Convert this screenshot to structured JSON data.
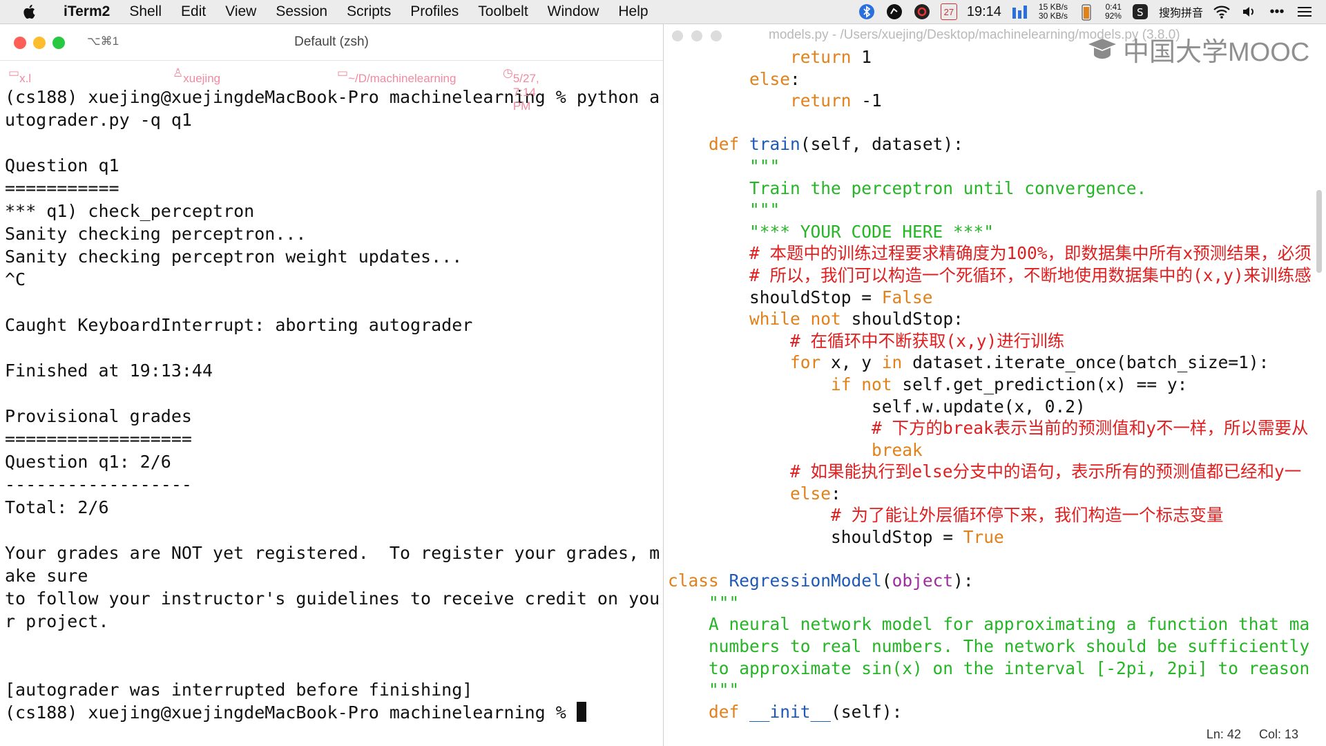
{
  "menubar": {
    "app_name": "iTerm2",
    "items": [
      "Shell",
      "Edit",
      "View",
      "Session",
      "Scripts",
      "Profiles",
      "Toolbelt",
      "Window",
      "Help"
    ],
    "status": {
      "date_day": "27",
      "time": "19:14",
      "net_up": "15 KB/s",
      "net_down": "30 KB/s",
      "battery_time": "0:41",
      "battery_pct": "92%",
      "ime": "搜狗拼音"
    }
  },
  "terminal": {
    "hotkey": "⌥⌘1",
    "title": "Default (zsh)",
    "info": {
      "host": "x.l",
      "user": "xuejing",
      "dir": "~/D/machinelearning",
      "datetime": "5/27, 7:14 PM"
    },
    "lines": [
      "(cs188) xuejing@xuejingdeMacBook-Pro machinelearning % python a",
      "utograder.py -q q1",
      "",
      "Question q1",
      "===========",
      "*** q1) check_perceptron",
      "Sanity checking perceptron...",
      "Sanity checking perceptron weight updates...",
      "^C",
      "",
      "Caught KeyboardInterrupt: aborting autograder",
      "",
      "Finished at 19:13:44",
      "",
      "Provisional grades",
      "==================",
      "Question q1: 2/6",
      "------------------",
      "Total: 2/6",
      "",
      "Your grades are NOT yet registered.  To register your grades, m",
      "ake sure",
      "to follow your instructor's guidelines to receive credit on you",
      "r project.",
      "",
      "",
      "[autograder was interrupted before finishing]"
    ],
    "prompt": "(cs188) xuejing@xuejingdeMacBook-Pro machinelearning % "
  },
  "editor": {
    "title": "models.py - /Users/xuejing/Desktop/machinelearning/models.py (3.8.0)",
    "watermark": "中国大学MOOC",
    "code": [
      [
        {
          "t": "            ",
          "c": "txt"
        },
        {
          "t": "return",
          "c": "kw"
        },
        {
          "t": " 1",
          "c": "txt"
        }
      ],
      [
        {
          "t": "        ",
          "c": "txt"
        },
        {
          "t": "else",
          "c": "kw"
        },
        {
          "t": ":",
          "c": "txt"
        }
      ],
      [
        {
          "t": "            ",
          "c": "txt"
        },
        {
          "t": "return",
          "c": "kw"
        },
        {
          "t": " -1",
          "c": "txt"
        }
      ],
      [
        {
          "t": "",
          "c": "txt"
        }
      ],
      [
        {
          "t": "    ",
          "c": "txt"
        },
        {
          "t": "def",
          "c": "def"
        },
        {
          "t": " ",
          "c": "txt"
        },
        {
          "t": "train",
          "c": "fn"
        },
        {
          "t": "(self, dataset):",
          "c": "txt"
        }
      ],
      [
        {
          "t": "        ",
          "c": "txt"
        },
        {
          "t": "\"\"\"",
          "c": "str"
        }
      ],
      [
        {
          "t": "        ",
          "c": "txt"
        },
        {
          "t": "Train the perceptron until convergence.",
          "c": "str"
        }
      ],
      [
        {
          "t": "        ",
          "c": "txt"
        },
        {
          "t": "\"\"\"",
          "c": "str"
        }
      ],
      [
        {
          "t": "        ",
          "c": "txt"
        },
        {
          "t": "\"*** YOUR CODE HERE ***\"",
          "c": "str"
        }
      ],
      [
        {
          "t": "        ",
          "c": "txt"
        },
        {
          "t": "# 本题中的训练过程要求精确度为100%，即数据集中所有x预测结果，必须",
          "c": "cm"
        }
      ],
      [
        {
          "t": "        ",
          "c": "txt"
        },
        {
          "t": "# 所以，我们可以构造一个死循环，不断地使用数据集中的(x,y)来训练感",
          "c": "cm"
        }
      ],
      [
        {
          "t": "        shouldStop = ",
          "c": "txt"
        },
        {
          "t": "False",
          "c": "bool"
        }
      ],
      [
        {
          "t": "        ",
          "c": "txt"
        },
        {
          "t": "while",
          "c": "kw"
        },
        {
          "t": " ",
          "c": "txt"
        },
        {
          "t": "not",
          "c": "kw"
        },
        {
          "t": " shouldStop:",
          "c": "txt"
        }
      ],
      [
        {
          "t": "            ",
          "c": "txt"
        },
        {
          "t": "# 在循环中不断获取(x,y)进行训练",
          "c": "cm"
        }
      ],
      [
        {
          "t": "            ",
          "c": "txt"
        },
        {
          "t": "for",
          "c": "kw"
        },
        {
          "t": " x, y ",
          "c": "txt"
        },
        {
          "t": "in",
          "c": "kw"
        },
        {
          "t": " dataset.iterate_once(batch_size=1):",
          "c": "txt"
        }
      ],
      [
        {
          "t": "                ",
          "c": "txt"
        },
        {
          "t": "if",
          "c": "kw"
        },
        {
          "t": " ",
          "c": "txt"
        },
        {
          "t": "not",
          "c": "kw"
        },
        {
          "t": " self.get_prediction(x) == y:",
          "c": "txt"
        }
      ],
      [
        {
          "t": "                    self.w.update(x, 0.2)",
          "c": "txt"
        }
      ],
      [
        {
          "t": "                    ",
          "c": "txt"
        },
        {
          "t": "# 下方的break表示当前的预测值和y不一样，所以需要从",
          "c": "cm"
        }
      ],
      [
        {
          "t": "                    ",
          "c": "txt"
        },
        {
          "t": "break",
          "c": "kw"
        }
      ],
      [
        {
          "t": "            ",
          "c": "txt"
        },
        {
          "t": "# 如果能执行到else分支中的语句，表示所有的预测值都已经和y一",
          "c": "cm"
        }
      ],
      [
        {
          "t": "            ",
          "c": "txt"
        },
        {
          "t": "else",
          "c": "kw"
        },
        {
          "t": ":",
          "c": "txt"
        }
      ],
      [
        {
          "t": "                ",
          "c": "txt"
        },
        {
          "t": "# 为了能让外层循环停下来，我们构造一个标志变量",
          "c": "cm"
        }
      ],
      [
        {
          "t": "                shouldStop = ",
          "c": "txt"
        },
        {
          "t": "True",
          "c": "bool"
        }
      ],
      [
        {
          "t": "",
          "c": "txt"
        }
      ],
      [
        {
          "t": "class",
          "c": "kw"
        },
        {
          "t": " ",
          "c": "txt"
        },
        {
          "t": "RegressionModel",
          "c": "cls"
        },
        {
          "t": "(",
          "c": "txt"
        },
        {
          "t": "object",
          "c": "obj"
        },
        {
          "t": "):",
          "c": "txt"
        }
      ],
      [
        {
          "t": "    ",
          "c": "txt"
        },
        {
          "t": "\"\"\"",
          "c": "str"
        }
      ],
      [
        {
          "t": "    ",
          "c": "txt"
        },
        {
          "t": "A neural network model for approximating a function that ma",
          "c": "str"
        }
      ],
      [
        {
          "t": "    ",
          "c": "txt"
        },
        {
          "t": "numbers to real numbers. The network should be sufficiently",
          "c": "str"
        }
      ],
      [
        {
          "t": "    ",
          "c": "txt"
        },
        {
          "t": "to approximate sin(x) on the interval [-2pi, 2pi] to reason",
          "c": "str"
        }
      ],
      [
        {
          "t": "    ",
          "c": "txt"
        },
        {
          "t": "\"\"\"",
          "c": "str"
        }
      ],
      [
        {
          "t": "    ",
          "c": "txt"
        },
        {
          "t": "def",
          "c": "def"
        },
        {
          "t": " ",
          "c": "txt"
        },
        {
          "t": "__init__",
          "c": "fn"
        },
        {
          "t": "(self):",
          "c": "txt"
        }
      ]
    ],
    "status": {
      "line": "Ln: 42",
      "col": "Col: 13"
    }
  }
}
